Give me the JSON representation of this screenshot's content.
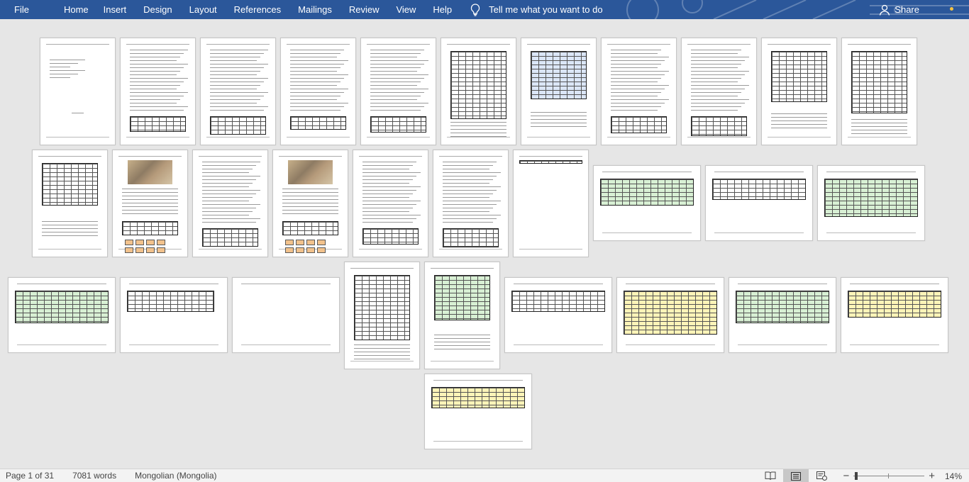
{
  "menubar": {
    "items": [
      "File",
      "Home",
      "Insert",
      "Design",
      "Layout",
      "References",
      "Mailings",
      "Review",
      "View",
      "Help"
    ],
    "tell_me": "Tell me what you want to do",
    "share": "Share"
  },
  "statusbar": {
    "page": "Page 1 of 31",
    "words": "7081 words",
    "language": "Mongolian (Mongolia)",
    "zoom": "14%",
    "zoom_percent": 14
  }
}
